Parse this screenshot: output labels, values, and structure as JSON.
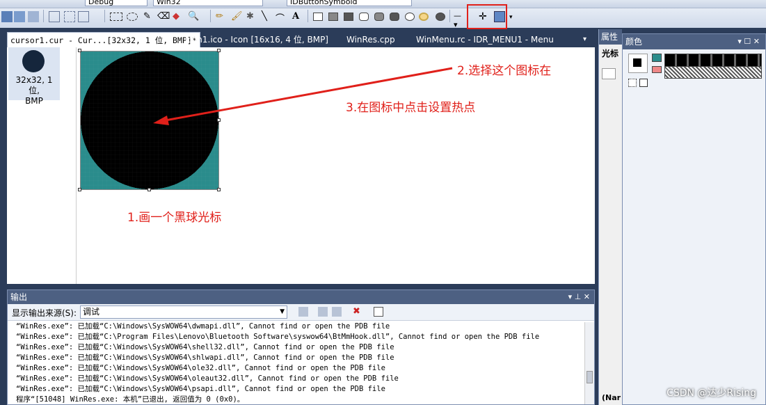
{
  "toolbar": {
    "config_combo": "Debug",
    "platform_combo": "Win32",
    "symbol_combo": "IDButtonSymbold"
  },
  "tabs": [
    {
      "label": "cursor1.cur - Cur...[32x32, 1 位, BMP]*"
    },
    {
      "label": "icon1.ico - Icon [16x16, 4 位, BMP]"
    },
    {
      "label": "WinRes.cpp"
    },
    {
      "label": "WinMenu.rc - IDR_MENU1 - Menu"
    }
  ],
  "thumbnail": {
    "label": "32x32, 1 位,\nBMP"
  },
  "annotations": {
    "step1": "1.画一个黑球光标",
    "step2": "2.选择这个图标在",
    "step3": "3.在图标中点击设置热点"
  },
  "props_panel": {
    "title": "属性",
    "subtitle": "光标",
    "bottom": "(Nar"
  },
  "colors_panel": {
    "title": "颜色"
  },
  "output": {
    "title": "输出",
    "source_label": "显示输出来源(S):",
    "source_value": "调试",
    "lines": [
      "“WinRes.exe”: 已加载“C:\\Windows\\SysWOW64\\dwmapi.dll”, Cannot find or open the PDB file",
      "“WinRes.exe”: 已加载“C:\\Program Files\\Lenovo\\Bluetooth Software\\syswow64\\BtMmHook.dll”, Cannot find or open the PDB file",
      "“WinRes.exe”: 已加载“C:\\Windows\\SysWOW64\\shell32.dll”, Cannot find or open the PDB file",
      "“WinRes.exe”: 已加载“C:\\Windows\\SysWOW64\\shlwapi.dll”, Cannot find or open the PDB file",
      "“WinRes.exe”: 已加载“C:\\Windows\\SysWOW64\\ole32.dll”, Cannot find or open the PDB file",
      "“WinRes.exe”: 已加载“C:\\Windows\\SysWOW64\\oleaut32.dll”, Cannot find or open the PDB file",
      "“WinRes.exe”: 已加载“C:\\Windows\\SysWOW64\\psapi.dll”, Cannot find or open the PDB file",
      "程序“[51048] WinRes.exe: 本机”已退出, 返回值为 0 (0x0)。"
    ]
  },
  "watermark": "CSDN @达少Rising",
  "colors": {
    "teal": "#2a8c8c",
    "black": "#000000",
    "accent_red": "#e0201a"
  }
}
